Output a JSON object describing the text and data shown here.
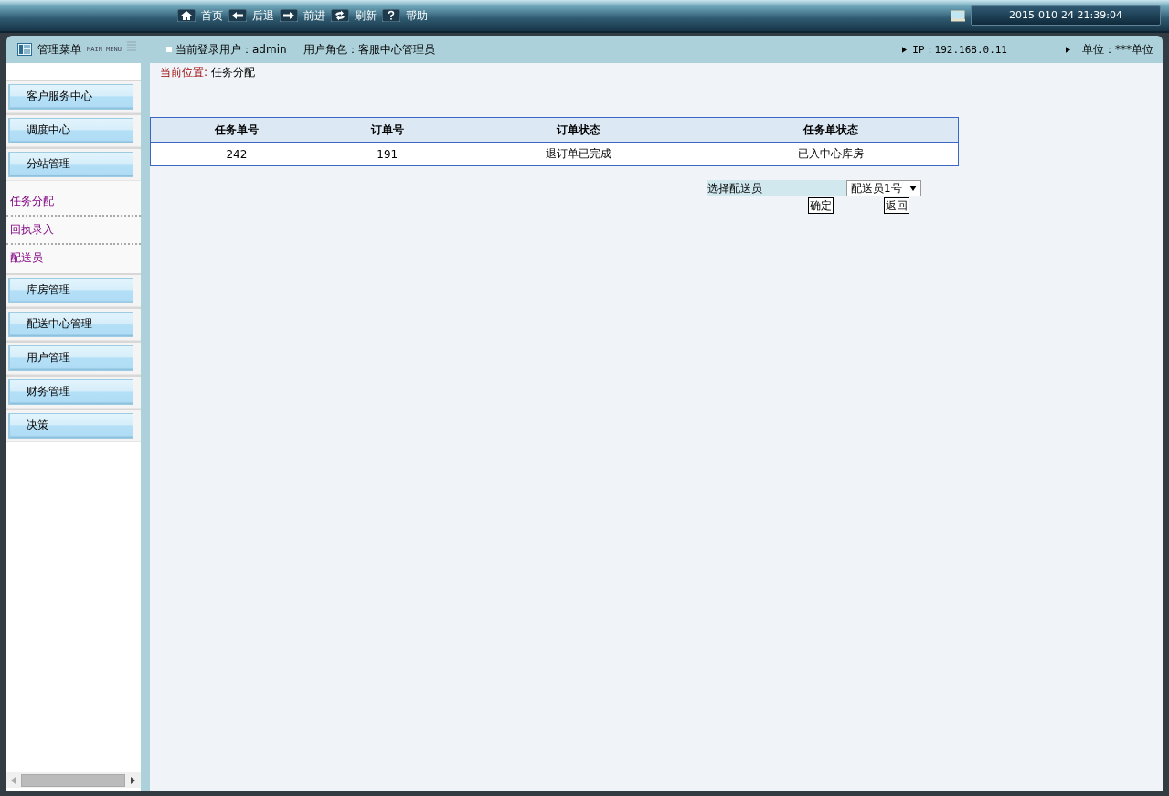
{
  "toolbar": {
    "nav": [
      {
        "kind": "home",
        "label": "首页"
      },
      {
        "kind": "back",
        "label": "后退"
      },
      {
        "kind": "forward",
        "label": "前进"
      },
      {
        "kind": "refresh",
        "label": "刷新"
      },
      {
        "kind": "help",
        "label": "帮助"
      }
    ],
    "datetime": "2015-010-24 21:39:04"
  },
  "header": {
    "menu_title": "管理菜单",
    "menu_subtitle": "MAIN MENU",
    "user": "当前登录用户：admin",
    "role": "用户角色：客服中心管理员",
    "ip": "IP：192.168.0.11",
    "unit": "单位：***单位"
  },
  "sidebar": {
    "items": [
      {
        "label": "客户服务中心"
      },
      {
        "label": "调度中心"
      },
      {
        "label": "分站管理",
        "children": [
          {
            "label": "任务分配"
          },
          {
            "label": "回执录入"
          },
          {
            "label": "配送员"
          }
        ]
      },
      {
        "label": "库房管理"
      },
      {
        "label": "配送中心管理"
      },
      {
        "label": "用户管理"
      },
      {
        "label": "财务管理"
      },
      {
        "label": "决策"
      }
    ]
  },
  "breadcrumb": {
    "label": "当前位置:",
    "value": "任务分配"
  },
  "table": {
    "columns": [
      "任务单号",
      "订单号",
      "订单状态",
      "任务单状态"
    ],
    "rows": [
      [
        "242",
        "191",
        "退订单已完成",
        "已入中心库房"
      ]
    ]
  },
  "form": {
    "label": "选择配送员",
    "select_value": "配送员1号",
    "buttons": [
      "确定",
      "返回"
    ]
  }
}
